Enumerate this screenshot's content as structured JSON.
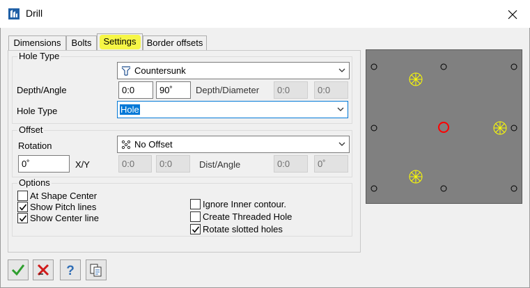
{
  "window": {
    "title": "Drill",
    "close_glyph": "✕"
  },
  "tabs": [
    {
      "label": "Dimensions",
      "active": false
    },
    {
      "label": "Bolts",
      "active": false
    },
    {
      "label": "Settings",
      "active": true
    },
    {
      "label": "Border offsets",
      "active": false
    }
  ],
  "hole_type_group": {
    "legend": "Hole Type",
    "style_select": {
      "value": "Countersunk",
      "icon": "countersunk-icon"
    },
    "depth_angle_label": "Depth/Angle",
    "depth_value": "0:0",
    "angle_value": "90˚",
    "depth_diameter_label": "Depth/Diameter",
    "depth_diameter_value1": "0:0",
    "depth_diameter_value2": "0:0",
    "hole_type_label": "Hole Type",
    "hole_type_select": {
      "value": "Hole"
    }
  },
  "offset_group": {
    "legend": "Offset",
    "rotation_label": "Rotation",
    "offset_select": {
      "value": "No Offset",
      "icon": "no-offset-icon"
    },
    "rotation_value": "0˚",
    "xy_label": "X/Y",
    "x_value": "0:0",
    "y_value": "0:0",
    "dist_angle_label": "Dist/Angle",
    "dist_value": "0:0",
    "angle_value": "0˚"
  },
  "options_group": {
    "legend": "Options",
    "left": [
      {
        "label": "At Shape Center",
        "checked": false
      },
      {
        "label": "Show Pitch lines",
        "checked": true
      },
      {
        "label": "Show Center line",
        "checked": true
      }
    ],
    "right": [
      {
        "label": "Ignore Inner contour.",
        "checked": false
      },
      {
        "label": "Create Threaded Hole",
        "checked": false
      },
      {
        "label": "Rotate slotted holes",
        "checked": true
      }
    ]
  },
  "preview": {
    "background": "#808080",
    "hole_color": "#000000",
    "bolt_color": "#ffff00",
    "center_hole_color": "#ff0000"
  },
  "bottom_buttons": [
    {
      "name": "ok-button",
      "icon": "check-icon"
    },
    {
      "name": "cancel-button",
      "icon": "cross-icon"
    },
    {
      "name": "help-button",
      "icon": "help-icon"
    },
    {
      "name": "copy-button",
      "icon": "copy-document-icon"
    }
  ],
  "colors": {
    "tab_highlight": "#f6f646",
    "selection": "#0078d7",
    "check_green": "#2e9e2e",
    "cancel_red": "#d01a1a",
    "help_blue": "#2f6db5"
  }
}
